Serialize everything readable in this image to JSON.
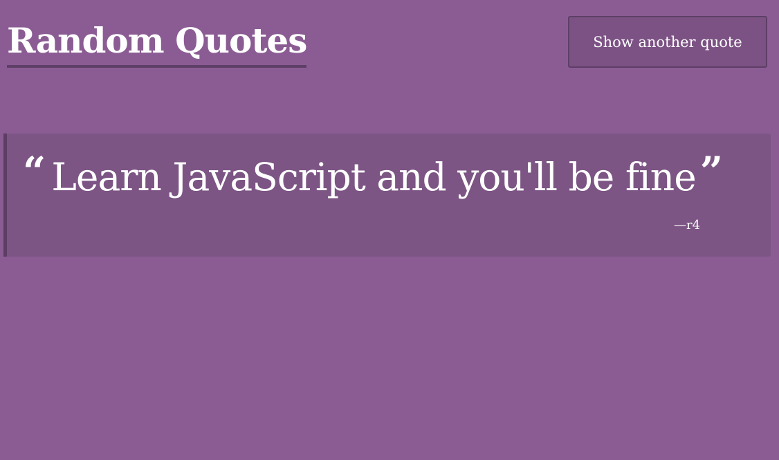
{
  "header": {
    "title": "Random Quotes",
    "button_label": "Show another quote"
  },
  "quote": {
    "open_mark": "“",
    "text": "Learn JavaScript and you'll be fine",
    "close_mark": "”",
    "author": "—r4"
  },
  "colors": {
    "background": "#8b5c93",
    "card_background": "#7c5584",
    "accent_border": "#5c3e63",
    "text": "#ffffff"
  }
}
